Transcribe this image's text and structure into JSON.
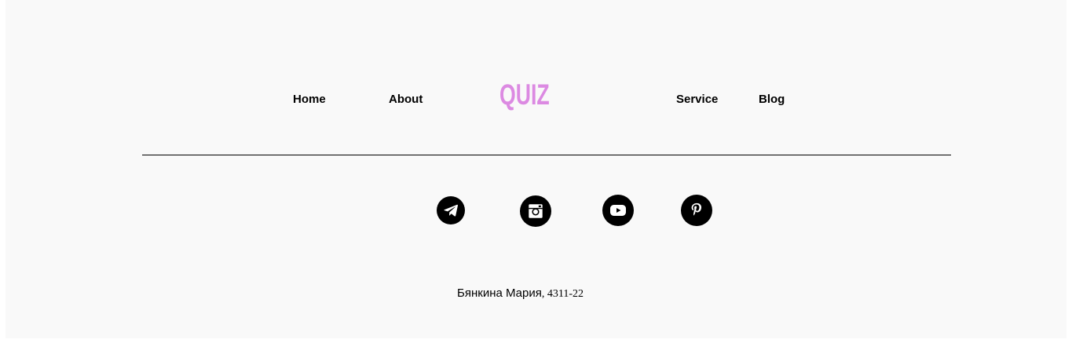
{
  "nav": {
    "home": "Home",
    "about": "About",
    "logo": "QUIZ",
    "service": "Service",
    "blog": "Blog"
  },
  "social": [
    {
      "icon": "telegram-icon"
    },
    {
      "icon": "instagram-icon"
    },
    {
      "icon": "youtube-icon"
    },
    {
      "icon": "pinterest-icon"
    }
  ],
  "footer": {
    "author": "Бянкина Мария",
    "group": ", 4311-22"
  },
  "colors": {
    "background": "#f9f9f9",
    "logo": "#dc8ae2",
    "text": "#000000"
  }
}
